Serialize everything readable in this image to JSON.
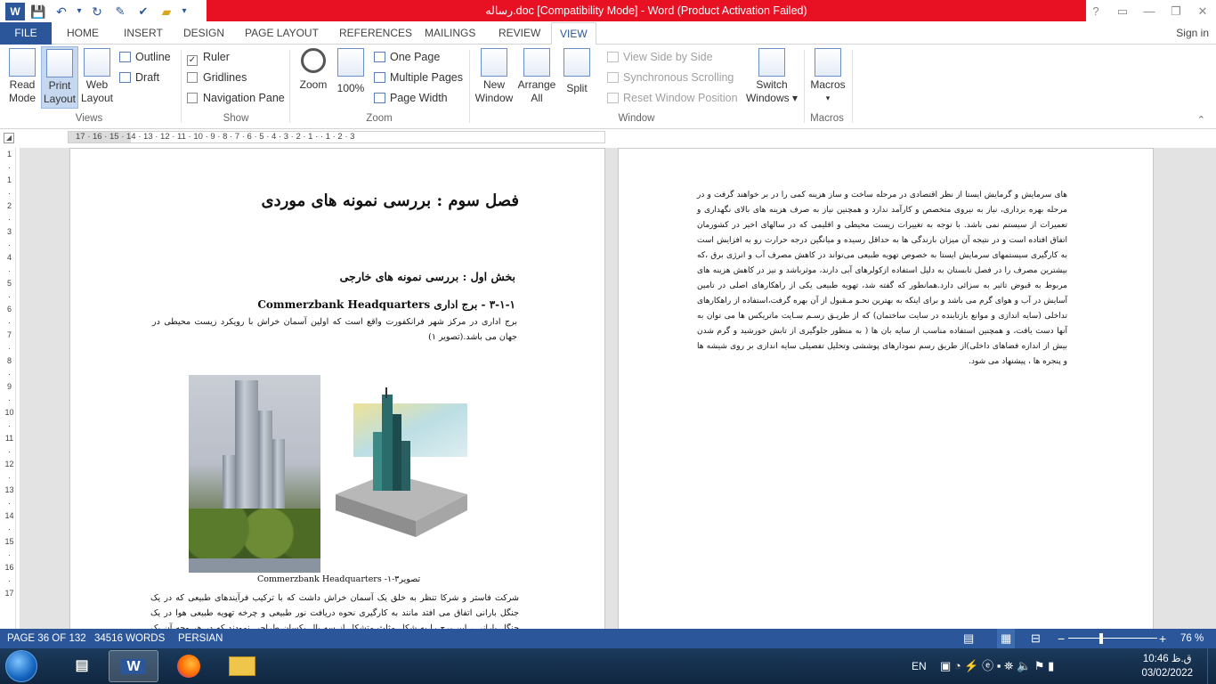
{
  "window": {
    "title": "رساله.doc [Compatibility Mode] -  Word (Product Activation Failed)",
    "help": "?",
    "restore_ribbon": "▭",
    "minimize": "—",
    "maximize": "❐",
    "close": "✕"
  },
  "qat": {
    "save": "💾",
    "undo": "↶",
    "dropdown": "▾",
    "redo": "↻"
  },
  "tabs": [
    "FILE",
    "HOME",
    "INSERT",
    "DESIGN",
    "PAGE LAYOUT",
    "REFERENCES",
    "MAILINGS",
    "REVIEW",
    "VIEW"
  ],
  "active_tab": "VIEW",
  "signin": "Sign in",
  "ribbon": {
    "views": {
      "read_mode": [
        "Read",
        "Mode"
      ],
      "print_layout": [
        "Print",
        "Layout"
      ],
      "web_layout": [
        "Web",
        "Layout"
      ],
      "outline": "Outline",
      "draft": "Draft",
      "label": "Views"
    },
    "show": {
      "ruler": "Ruler",
      "ruler_checked": "✓",
      "gridlines": "Gridlines",
      "navigation_pane": "Navigation Pane",
      "label": "Show"
    },
    "zoom": {
      "zoom": "Zoom",
      "percent": "100%",
      "one_page": "One Page",
      "multiple_pages": "Multiple Pages",
      "page_width": "Page Width",
      "label": "Zoom"
    },
    "window": {
      "new_window": [
        "New",
        "Window"
      ],
      "arrange_all": [
        "Arrange",
        "All"
      ],
      "split": "Split",
      "view_side_by_side": "View Side by Side",
      "synchronous_scrolling": "Synchronous Scrolling",
      "reset_window_position": "Reset Window Position",
      "switch_windows": [
        "Switch",
        "Windows ▾"
      ],
      "label": "Window"
    },
    "macros": {
      "macros": [
        "Macros",
        "▾"
      ],
      "label": "Macros"
    },
    "collapse": "⌃"
  },
  "ruler": {
    "corner": "◢",
    "horizontal": "17  ·  16  ·  15  ·  14  ·  13  ·  12  ·  11  ·  10  ·  9  ·  8  ·  7  ·  6  ·  5  ·  4  ·  3  ·  2  ·  1  ·     ·  1  ·  2  ·  3",
    "vertical": [
      "1",
      "·",
      "1",
      "·",
      "2",
      "·",
      "3",
      "·",
      "4",
      "·",
      "5",
      "·",
      "6",
      "·",
      "7",
      "·",
      "8",
      "·",
      "9",
      "·",
      "10",
      "·",
      "11",
      "·",
      "12",
      "·",
      "13",
      "·",
      "14",
      "·",
      "15",
      "·",
      "16",
      "·",
      "17"
    ]
  },
  "document": {
    "chapter_title": "فصل سوم : بررسی نمونه های موردی",
    "section_title": "بخش اول : بررسی نمونه های خارجی",
    "case_heading": "۳-۱-۱ - برج اداری Commerzbank Headquarters",
    "case_para": "برج اداری در مرکز شهر فرانکفورت  واقع است که اولین آسمان خراش با رویکرد زیست محیطی در جهان می باشد.(تصویر ۱)",
    "caption": "تصویر۳-۱- Commerzbank Headquarters",
    "para_bottom": "شرکت  فاستر  و شرکا  تنظر به خلق یک آسمان خراش داشت که با ترکیب فرآیندهای طبیعی که در یک جنگل بارانی اتفاق می افتد مانند به  کارگیری نحوه دریافت نور طبیعی و چرخه تهویه طبیعی هوا در یک جنگل بارانی ، این برج را به شکل مثلث متشکل از سه بال یکسان طراحی نمودند که در هر وجه آن یک آتریوم به ارتفاع کل برج قرار گرفته است.",
    "right_page_para": "های سرمایش و گرمایش ایستا از نظر اقتصادی در مرحله ساخت و ساز هزینه کمی را در بر خواهند گرفت و در مرحله بهره برداری، نیاز به نیروی متخصص و کارآمد ندارد و همچنین نیاز به صرف هزینه های بالای نگهداری و تعمیرات از سیستم نمی باشد. با توجه به تغییرات زیست محیطی و اقلیمی که در سالهای اخیر در کشورمان اتفاق افتاده است و در نتیجه آن میزان بارندگی ها به حداقل رسیده و میانگین درجه حرارت رو به افزایش است به کارگیری سیستمهای سرمایش ایستا به خصوص تهویه طبیعی می‌تواند در کاهش مصرف آب و انرژی برق ،که بیشترین مصرف را در فصل تابستان به دلیل استفاده ازکولرهای آبی دارند، موثرباشد و نیز در کاهش هزینه های مربوط به قبوض تاثیر به سزائی دارد.همانطور که گفته شد، تهویه طبیعی یکی از راهکارهای اصلی در تامین آسایش در آب و هوای گرم می باشد و برای اینکه به بهترین نحـو مـقبول از آن بهره گرفت،استفاده از راهکارهای تداخلی (سایه اندازی و موانع بازتابنده در سایت ساختمان) که از طریـق رسـم سـایت ماتریکس ها می توان به آنها دست یافت، و همچنین استفاده مناسب از سایه بان ها ( به منظور جلوگیری از تابش خورشید و گرم شدن بیش از اندازه فضاهای داخلی)از طریق رسم نمودارهای پوششی وتحلیل تفصیلی سایه اندازی بر روی شیشه ها و پنجره ها ، پیشنهاد می شود."
  },
  "status": {
    "page": "PAGE 36 OF 132",
    "words": "34516 WORDS",
    "language": "PERSIAN",
    "zoom": "76 %",
    "zoom_level_percent": 76,
    "minus": "−",
    "plus": "+"
  },
  "taskbar": {
    "word": "W",
    "lang": "EN",
    "time": "10:46 ق.ظ",
    "date": "03/02/2022"
  },
  "colors": {
    "accent": "#2b579a",
    "error_bar": "#e81123",
    "taskbar": "#16304e"
  }
}
